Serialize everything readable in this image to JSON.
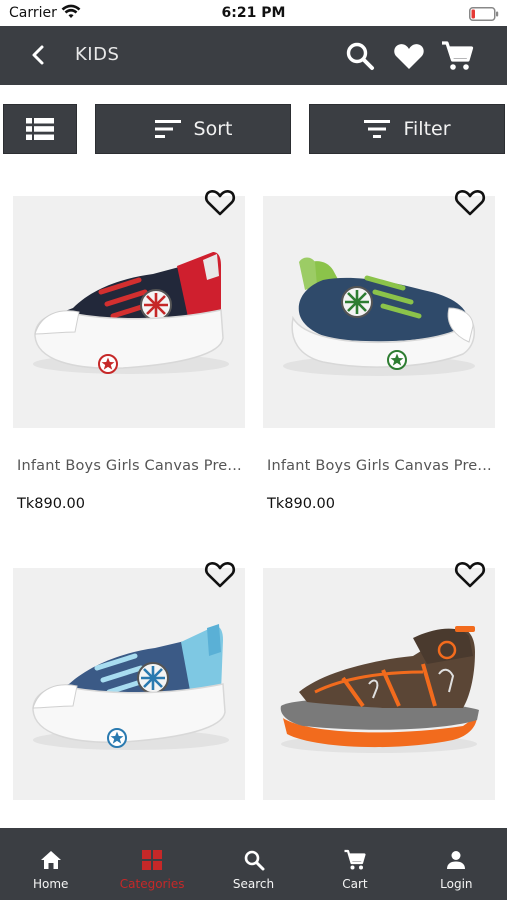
{
  "status_bar": {
    "carrier": "Carrier",
    "time": "6:21 PM"
  },
  "header": {
    "title": "KIDS",
    "icons": [
      "back-arrow-icon",
      "search-icon",
      "heart-icon",
      "cart-icon"
    ]
  },
  "toolbar": {
    "sort_label": "Sort",
    "filter_label": "Filter",
    "icons": [
      "list-view-icon",
      "sort-icon",
      "filter-icon"
    ]
  },
  "products": [
    {
      "name": "Infant Boys Girls Canvas Pre...",
      "price": "Tk890.00",
      "image": "navy-red-canvas-shoe"
    },
    {
      "name": "Infant Boys Girls Canvas Pre...",
      "price": "Tk890.00",
      "image": "navy-green-canvas-shoe"
    },
    {
      "name": "",
      "price": "",
      "image": "denim-blue-canvas-shoe"
    },
    {
      "name": "",
      "price": "",
      "image": "brown-orange-sandal"
    }
  ],
  "bottom_nav": {
    "items": [
      {
        "label": "Home",
        "icon": "home-icon"
      },
      {
        "label": "Categories",
        "icon": "grid-icon",
        "active": true
      },
      {
        "label": "Search",
        "icon": "search-icon"
      },
      {
        "label": "Cart",
        "icon": "cart-icon"
      },
      {
        "label": "Login",
        "icon": "person-icon"
      }
    ]
  },
  "colors": {
    "bar_background": "#3b3e43",
    "active_nav": "#c62828",
    "image_background": "#f0f0f0"
  }
}
